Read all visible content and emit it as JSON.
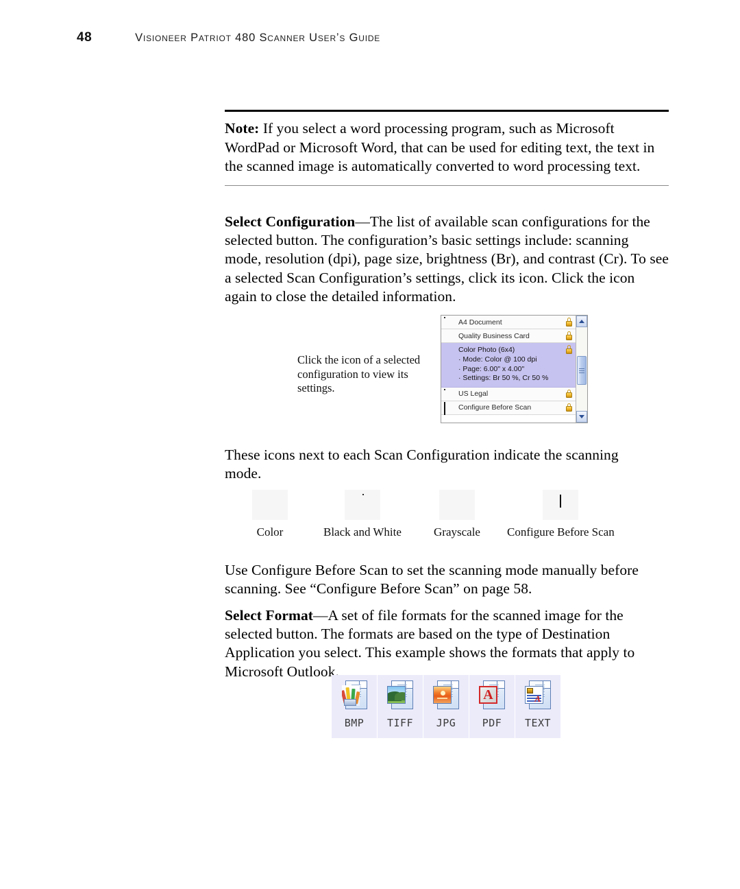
{
  "header": {
    "page_number": "48",
    "title": "Visioneer Patriot 480 Scanner User’s Guide"
  },
  "note_box": {
    "label": "Note:",
    "text": " If you select a word processing program, such as Microsoft WordPad or Microsoft Word, that can be used for editing text, the text in the scanned image is automatically converted to word processing text."
  },
  "paragraphs": {
    "select_configuration": {
      "lead": "Select Configuration",
      "body": "—The list of available scan configurations for the selected button. The configuration’s basic settings include: scanning mode, resolution (dpi), page size, brightness (Br), and contrast (Cr). To see a selected Scan Configuration’s settings, click its icon. Click the icon again to close the detailed information."
    },
    "these_icons": "These icons next to each Scan Configuration indicate the scanning mode.",
    "use_configure_before_scan": "Use Configure Before Scan to set the scanning mode manually before scanning. See “Configure Before Scan” on page 58.",
    "select_format": {
      "lead": "Select Format",
      "body": "—A set of file formats for the scanned image for the selected button. The formats are based on the type of Destination Application you select. This example shows the formats that apply to Microsoft Outlook."
    }
  },
  "callout": {
    "caption": "Click the icon of a selected configuration to view its settings."
  },
  "config_list": {
    "rows": [
      {
        "label": "A4 Document",
        "icon": "black-and-white-mode-icon",
        "locked": true,
        "selected": false
      },
      {
        "label": "Quality Business Card",
        "icon": "grayscale-mode-icon",
        "locked": true,
        "selected": false
      },
      {
        "label": "Color Photo (6x4)",
        "icon": "color-mode-icon",
        "locked": true,
        "selected": true,
        "details": [
          "· Mode: Color @ 100 dpi",
          "· Page:  6.00\" x  4.00\"",
          "· Settings: Br 50 %, Cr 50 %"
        ]
      },
      {
        "label": "US Legal",
        "icon": "black-and-white-mode-icon",
        "locked": true,
        "selected": false
      },
      {
        "label": "Configure Before Scan",
        "icon": "configure-before-scan-icon",
        "locked": true,
        "selected": false
      }
    ],
    "scrollbar": {
      "up_arrow": "▲",
      "down_arrow": "▼"
    },
    "selected_highlight_color": "#c7c3f0",
    "lock_color": "#f0b428"
  },
  "mode_icons": [
    {
      "label": "Color",
      "icon": "color-mode-icon"
    },
    {
      "label": "Black and White",
      "icon": "black-and-white-mode-icon"
    },
    {
      "label": "Grayscale",
      "icon": "grayscale-mode-icon"
    },
    {
      "label": "Configure Before Scan",
      "icon": "configure-before-scan-icon"
    }
  ],
  "format_icons": [
    {
      "label": "BMP",
      "icon": "bmp-file-icon"
    },
    {
      "label": "TIFF",
      "icon": "tiff-file-icon"
    },
    {
      "label": "JPG",
      "icon": "jpg-file-icon"
    },
    {
      "label": "PDF",
      "icon": "pdf-file-icon"
    },
    {
      "label": "TEXT",
      "icon": "text-file-icon"
    }
  ],
  "colors": {
    "format_tile_background": "#ecebfa",
    "selected_row": "#c7c3f0",
    "rule_top": "#000000",
    "rule_bottom": "#8a8a8a"
  }
}
